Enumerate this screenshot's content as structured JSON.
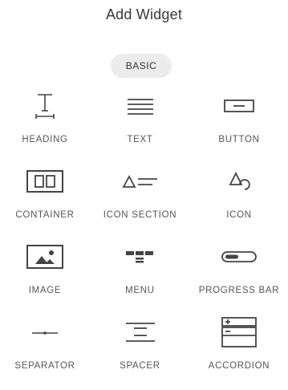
{
  "header": {
    "title": "Add Widget"
  },
  "tabs": {
    "basic_label": "BASIC"
  },
  "widgets": [
    {
      "label": "HEADING",
      "icon": "heading-icon"
    },
    {
      "label": "TEXT",
      "icon": "text-icon"
    },
    {
      "label": "BUTTON",
      "icon": "button-icon"
    },
    {
      "label": "CONTAINER",
      "icon": "container-icon"
    },
    {
      "label": "ICON SECTION",
      "icon": "icon-section-icon"
    },
    {
      "label": "ICON",
      "icon": "icon-icon"
    },
    {
      "label": "IMAGE",
      "icon": "image-icon"
    },
    {
      "label": "MENU",
      "icon": "menu-icon"
    },
    {
      "label": "PROGRESS BAR",
      "icon": "progress-bar-icon"
    },
    {
      "label": "SEPARATOR",
      "icon": "separator-icon"
    },
    {
      "label": "SPACER",
      "icon": "spacer-icon"
    },
    {
      "label": "ACCORDION",
      "icon": "accordion-icon"
    }
  ],
  "colors": {
    "icon": "#444444",
    "label": "#555555",
    "tab_bg": "#ececec"
  }
}
